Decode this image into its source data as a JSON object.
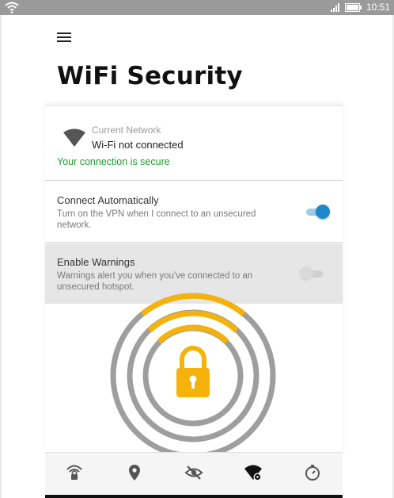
{
  "statusbar": {
    "time": "10:51"
  },
  "page": {
    "title": "WiFi Security"
  },
  "network": {
    "label": "Current Network",
    "value": "Wi-Fi not connected",
    "status": "Your connection is secure"
  },
  "settings": [
    {
      "title": "Connect Automatically",
      "description": "Turn on the VPN when I connect to an unsecured network.",
      "enabled": true
    },
    {
      "title": "Enable Warnings",
      "description": "Warnings alert you when you've connected to an unsecured hotspot.",
      "enabled": false
    }
  ],
  "icons": {
    "statusbar": [
      "wifi-icon",
      "signal-icon",
      "battery-icon"
    ],
    "nav": [
      "wifi-lock-icon",
      "location-pin-icon",
      "eye-off-icon",
      "wifi-settings-icon",
      "timer-icon"
    ]
  },
  "colors": {
    "accent": "#f5b20b",
    "toggle_on": "#1e88c9",
    "secure_green": "#1e9d2b"
  }
}
